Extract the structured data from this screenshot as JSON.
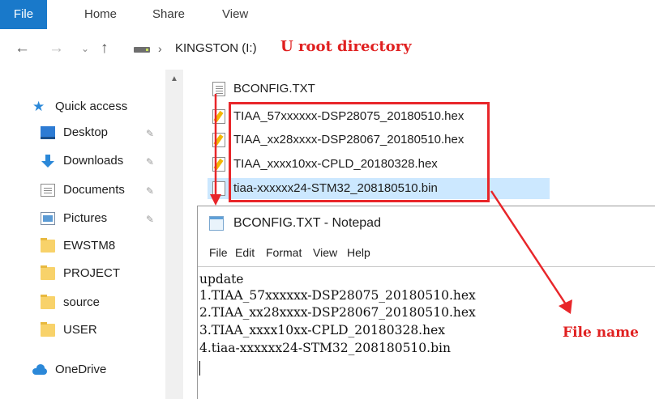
{
  "ribbon": {
    "tabs": [
      "File",
      "Home",
      "Share",
      "View"
    ]
  },
  "address": {
    "back_icon": "←",
    "forward_icon": "→",
    "recent_icon": "⌄",
    "up_icon": "↑",
    "separator": "›",
    "location": "KINGSTON (I:)"
  },
  "annotations": {
    "root_note": "U root directory",
    "file_name_note": "File name",
    "accent_color": "#e8262a"
  },
  "nav_pane": {
    "items": [
      {
        "label": "Quick access",
        "icon": "star-icon"
      },
      {
        "label": "Desktop",
        "icon": "desktop-icon",
        "pinned": true
      },
      {
        "label": "Downloads",
        "icon": "download-icon",
        "pinned": true
      },
      {
        "label": "Documents",
        "icon": "documents-icon",
        "pinned": true
      },
      {
        "label": "Pictures",
        "icon": "pictures-icon",
        "pinned": true
      },
      {
        "label": "EWSTM8",
        "icon": "folder-icon"
      },
      {
        "label": "PROJECT",
        "icon": "folder-icon"
      },
      {
        "label": "source",
        "icon": "folder-icon"
      },
      {
        "label": "USER",
        "icon": "folder-icon"
      },
      {
        "label": "OneDrive",
        "icon": "cloud-icon"
      }
    ]
  },
  "files": [
    {
      "name": "BCONFIG.TXT",
      "icon": "text-file-icon"
    },
    {
      "name": "TIAA_57xxxxxx-DSP28075_20180510.hex",
      "icon": "hex-file-icon"
    },
    {
      "name": "TIAA_xx28xxxx-DSP28067_20180510.hex",
      "icon": "hex-file-icon"
    },
    {
      "name": "TIAA_xxxx10xx-CPLD_20180328.hex",
      "icon": "hex-file-icon"
    },
    {
      "name": "tiaa-xxxxxx24-STM32_208180510.bin",
      "icon": "bin-file-icon",
      "selected": true
    }
  ],
  "notepad": {
    "title": "BCONFIG.TXT - Notepad",
    "menu": [
      "File",
      "Edit",
      "Format",
      "View",
      "Help"
    ],
    "lines": [
      "update",
      "1.TIAA_57xxxxxx-DSP28075_20180510.hex",
      "2.TIAA_xx28xxxx-DSP28067_20180510.hex",
      "3.TIAA_xxxx10xx-CPLD_20180328.hex",
      "4.tiaa-xxxxxx24-STM32_208180510.bin"
    ]
  }
}
